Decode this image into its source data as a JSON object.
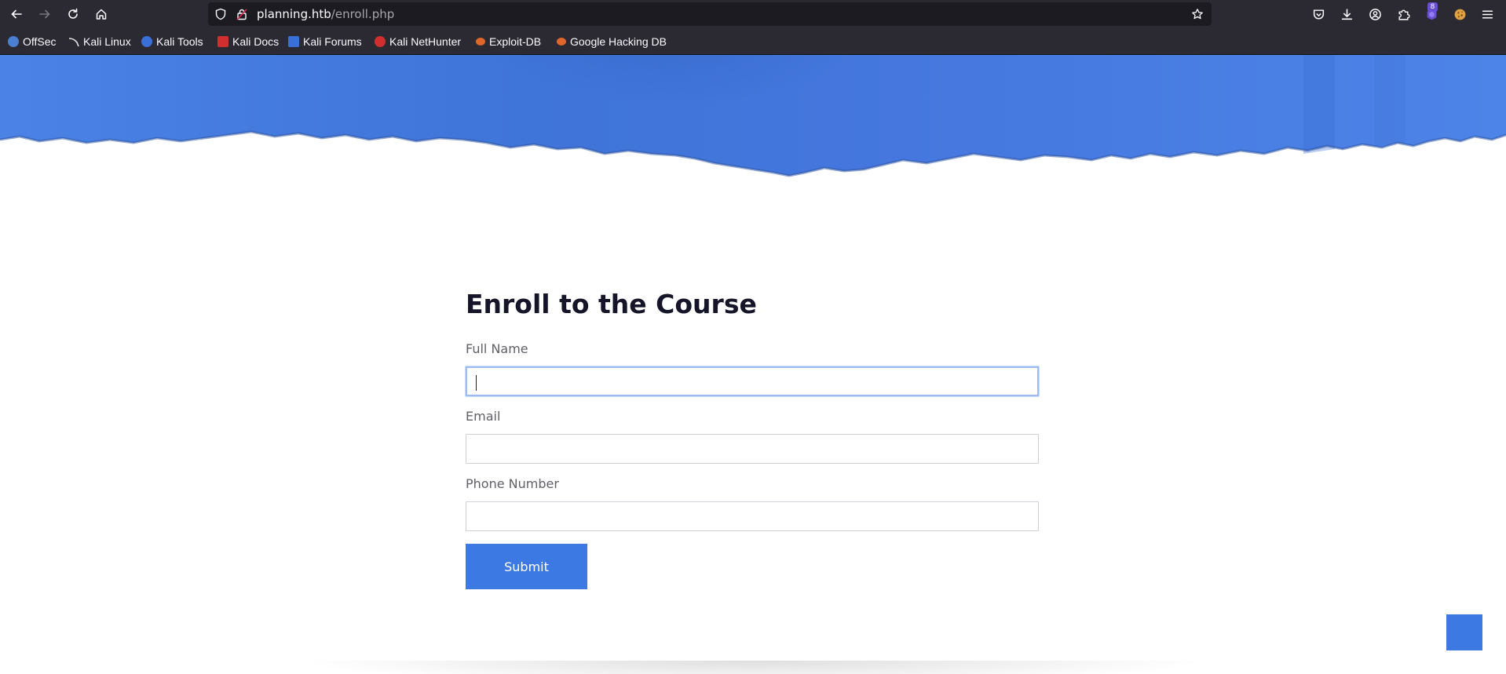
{
  "browser": {
    "url_host": "planning.htb",
    "url_path": "/enroll.php",
    "extension_badge": "8",
    "bookmarks": [
      {
        "label": "OffSec",
        "color": "#4a7fd1"
      },
      {
        "label": "Kali Linux",
        "color": "#111111"
      },
      {
        "label": "Kali Tools",
        "color": "#3a6fd8"
      },
      {
        "label": "Kali Docs",
        "color": "#d12f2f"
      },
      {
        "label": "Kali Forums",
        "color": "#3a6fd8"
      },
      {
        "label": "Kali NetHunter",
        "color": "#d12f2f"
      },
      {
        "label": "Exploit-DB",
        "color": "#e0662a"
      },
      {
        "label": "Google Hacking DB",
        "color": "#e0662a"
      }
    ]
  },
  "form": {
    "title": "Enroll to the Course",
    "full_name_label": "Full Name",
    "full_name_value": "",
    "email_label": "Email",
    "email_value": "",
    "phone_label": "Phone Number",
    "phone_value": "",
    "submit_label": "Submit"
  },
  "colors": {
    "accent": "#3d79e2",
    "hero_blue": "#4a80e4",
    "title": "#151428",
    "label": "#606068"
  }
}
